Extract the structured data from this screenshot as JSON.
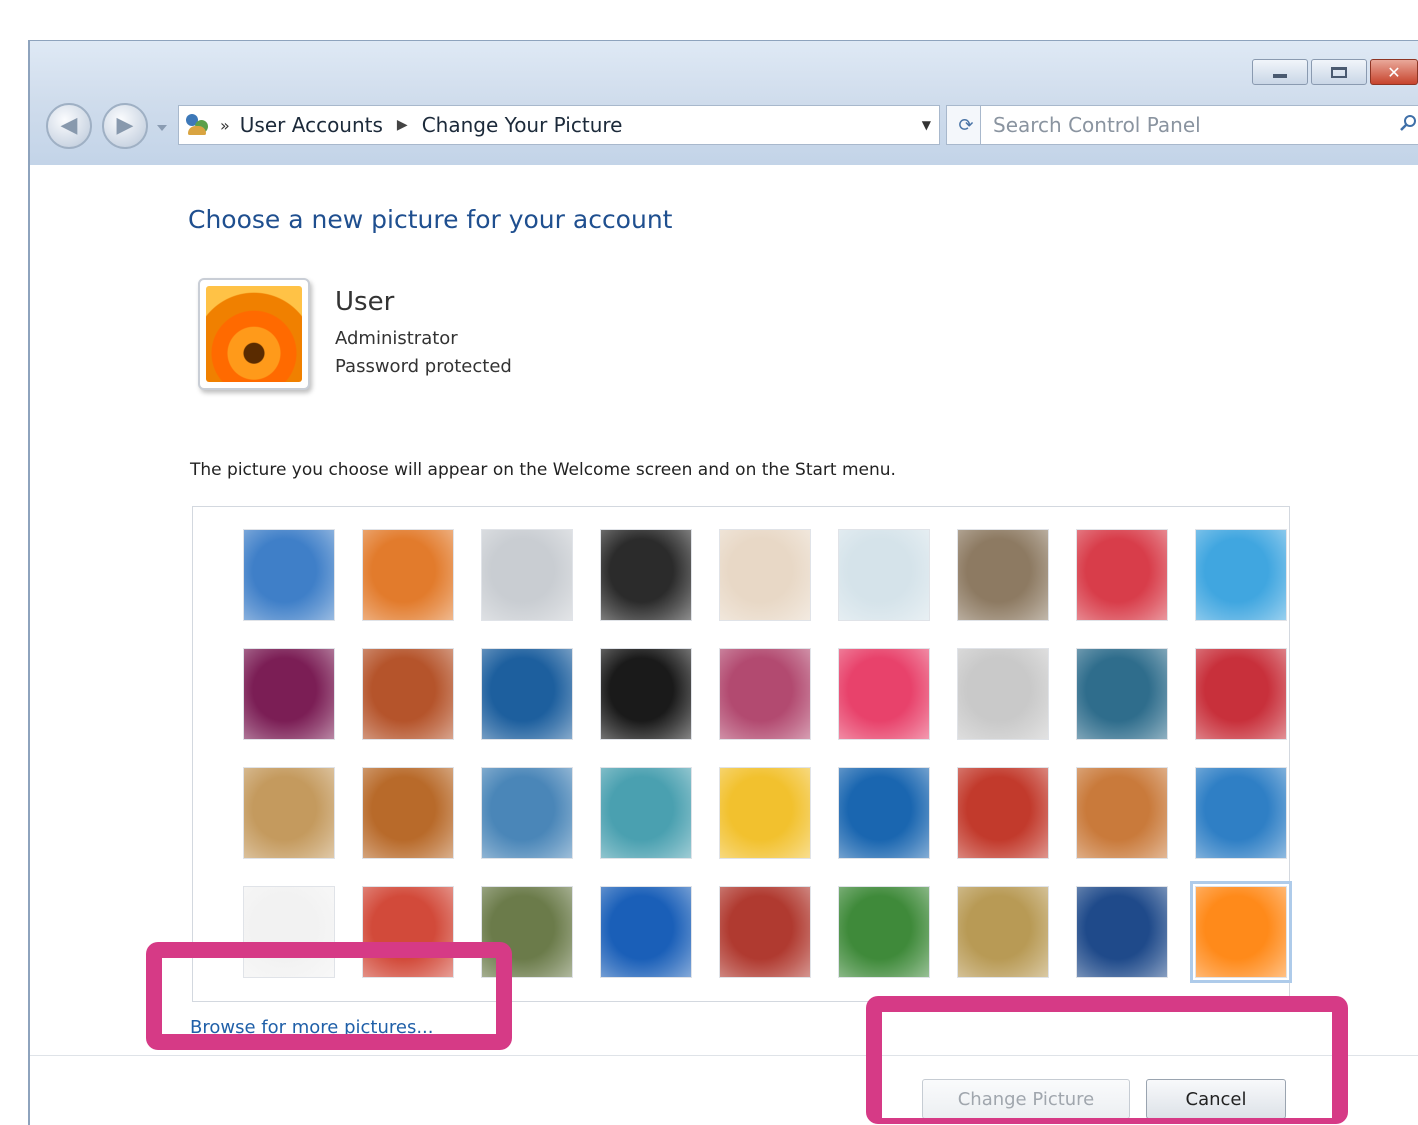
{
  "window": {
    "address_crumb_overflow": "»",
    "address_crumbs": [
      "User Accounts",
      "Change Your Picture"
    ],
    "search_placeholder": "Search Control Panel",
    "close_glyph": "✕"
  },
  "heading": "Choose a new picture for your account",
  "account": {
    "name": "User",
    "role": "Administrator",
    "status": "Password protected"
  },
  "description": "The picture you choose will appear on the Welcome screen and on the Start menu.",
  "pictures": [
    [
      "#3f7fc8",
      "#e27b2c",
      "#c9cdd2",
      "#2b2b2b",
      "#e8d8c6",
      "#d5e3ea",
      "#8d7a62",
      "#d83d4a",
      "#40a6e0"
    ],
    [
      "#7b1e55",
      "#b5542b",
      "#1d5f9e",
      "#1a1a1a",
      "#b24a70",
      "#e8426b",
      "#c9c9c9",
      "#2f6d8c",
      "#c8303b"
    ],
    [
      "#c49a5e",
      "#b86a2a",
      "#4a86b8",
      "#4aa0b0",
      "#f2c12e",
      "#1a66b0",
      "#c23a2c",
      "#c97a3b",
      "#2f7fc5"
    ],
    [
      "#f2f2f2",
      "#d24a3a",
      "#6b7b4a",
      "#1a5fb8",
      "#b03a30",
      "#3f8a3a",
      "#b89a55",
      "#1f4a8a",
      "#ff8a1a"
    ]
  ],
  "selected_picture": "Flower (orange gerbera)",
  "browse_link": "Browse for more pictures...",
  "buttons": {
    "change": "Change Picture",
    "cancel": "Cancel"
  }
}
